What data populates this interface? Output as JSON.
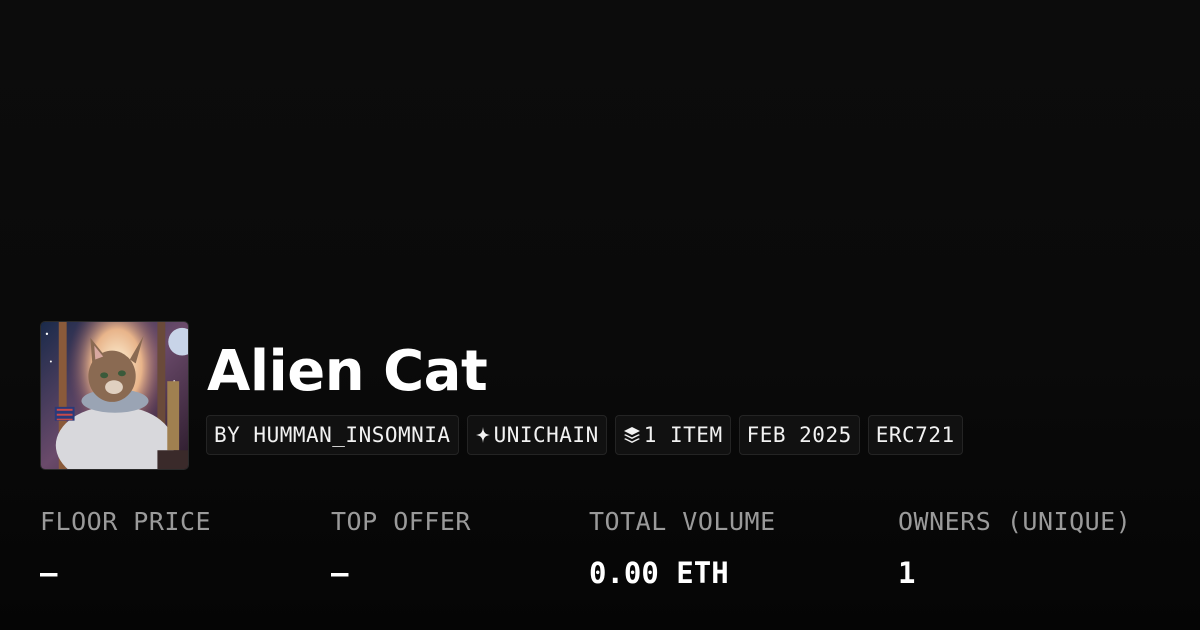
{
  "collection": {
    "name": "Alien Cat"
  },
  "tags": [
    {
      "label": "BY HUMMAN_INSOMNIA",
      "icon": null
    },
    {
      "label": "UNICHAIN",
      "icon": "sparkle-icon"
    },
    {
      "label": "1 ITEM",
      "icon": "layers-icon"
    },
    {
      "label": "FEB 2025",
      "icon": null
    },
    {
      "label": "ERC721",
      "icon": null
    }
  ],
  "stats": [
    {
      "label": "FLOOR PRICE",
      "value": "—"
    },
    {
      "label": "TOP OFFER",
      "value": "—"
    },
    {
      "label": "TOTAL VOLUME",
      "value": "0.00 ETH"
    },
    {
      "label": "OWNERS (UNIQUE)",
      "value": "1"
    }
  ],
  "colors": {
    "background": "#0a0a0a",
    "tag_background": "#111111",
    "tag_border": "#242424",
    "label_gray": "#9a9a9a",
    "text_white": "#ffffff"
  }
}
